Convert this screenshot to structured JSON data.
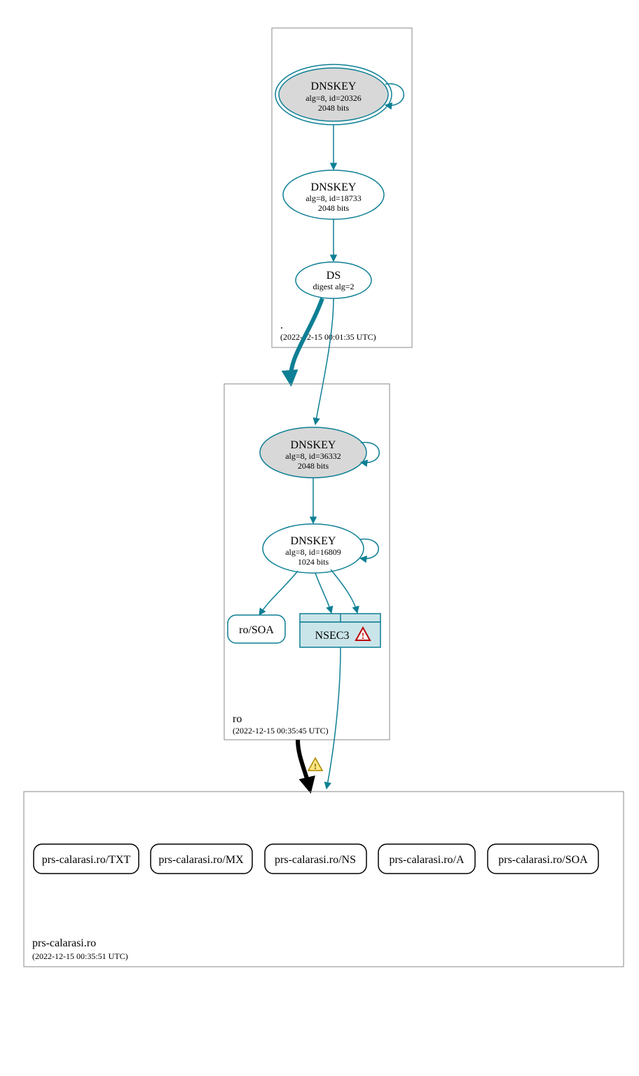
{
  "zones": {
    "root": {
      "label": ".",
      "timestamp": "(2022-12-15 00:01:35 UTC)",
      "ksk": {
        "title": "DNSKEY",
        "line1": "alg=8, id=20326",
        "line2": "2048 bits"
      },
      "zsk": {
        "title": "DNSKEY",
        "line1": "alg=8, id=18733",
        "line2": "2048 bits"
      },
      "ds": {
        "title": "DS",
        "line1": "digest alg=2"
      }
    },
    "ro": {
      "label": "ro",
      "timestamp": "(2022-12-15 00:35:45 UTC)",
      "ksk": {
        "title": "DNSKEY",
        "line1": "alg=8, id=36332",
        "line2": "2048 bits"
      },
      "zsk": {
        "title": "DNSKEY",
        "line1": "alg=8, id=16809",
        "line2": "1024 bits"
      },
      "soa": "ro/SOA",
      "nsec3": "NSEC3"
    },
    "leaf": {
      "label": "prs-calarasi.ro",
      "timestamp": "(2022-12-15 00:35:51 UTC)",
      "records": [
        "prs-calarasi.ro/TXT",
        "prs-calarasi.ro/MX",
        "prs-calarasi.ro/NS",
        "prs-calarasi.ro/A",
        "prs-calarasi.ro/SOA"
      ]
    }
  }
}
